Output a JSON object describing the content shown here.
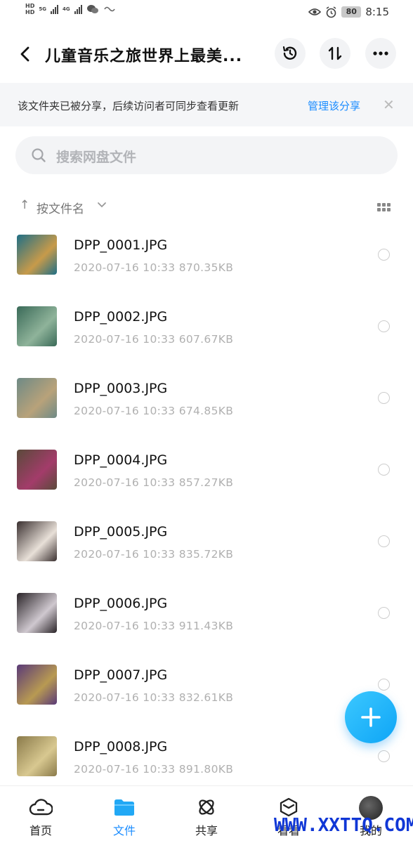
{
  "status_bar": {
    "left_hd_top": "HD",
    "left_hd_bottom": "HD",
    "net_5g": "5G",
    "net_4g": "4G",
    "battery": "80",
    "time": "8:15"
  },
  "header": {
    "title": "儿童音乐之旅世界上最美...",
    "history_icon": "history-icon",
    "sort_icon": "swap-vertical-icon",
    "more_icon": "more-horizontal-icon"
  },
  "banner": {
    "text": "该文件夹已被分享，后续访问者可同步查看更新",
    "link": "管理该分享",
    "close": "✕"
  },
  "search": {
    "placeholder": "搜索网盘文件"
  },
  "sort": {
    "arrow": "↑",
    "label": "按文件名"
  },
  "files": [
    {
      "name": "DPP_0001.JPG",
      "meta": "2020-07-16  10:33  870.35KB",
      "c1": "#1f6f86",
      "c2": "#c79a4a"
    },
    {
      "name": "DPP_0002.JPG",
      "meta": "2020-07-16  10:33  607.67KB",
      "c1": "#3a6a58",
      "c2": "#8fb39a"
    },
    {
      "name": "DPP_0003.JPG",
      "meta": "2020-07-16  10:33  674.85KB",
      "c1": "#6e8a86",
      "c2": "#b8a27a"
    },
    {
      "name": "DPP_0004.JPG",
      "meta": "2020-07-16  10:33  857.27KB",
      "c1": "#5a4a3a",
      "c2": "#a33c6a"
    },
    {
      "name": "DPP_0005.JPG",
      "meta": "2020-07-16  10:33  835.72KB",
      "c1": "#3a3030",
      "c2": "#e8e0d8"
    },
    {
      "name": "DPP_0006.JPG",
      "meta": "2020-07-16  10:33  911.43KB",
      "c1": "#2a2428",
      "c2": "#cfc8cf"
    },
    {
      "name": "DPP_0007.JPG",
      "meta": "2020-07-16  10:33  832.61KB",
      "c1": "#5a3a78",
      "c2": "#b89a52"
    },
    {
      "name": "DPP_0008.JPG",
      "meta": "2020-07-16  10:33  891.80KB",
      "c1": "#8a7a4a",
      "c2": "#d8c890"
    }
  ],
  "fab": {
    "icon": "plus-icon"
  },
  "bottom_nav": {
    "items": [
      {
        "label": "首页"
      },
      {
        "label": "文件"
      },
      {
        "label": "共享"
      },
      {
        "label": "看看"
      },
      {
        "label": "我的"
      }
    ]
  },
  "watermark": "WWW.XXTTQ.COM"
}
